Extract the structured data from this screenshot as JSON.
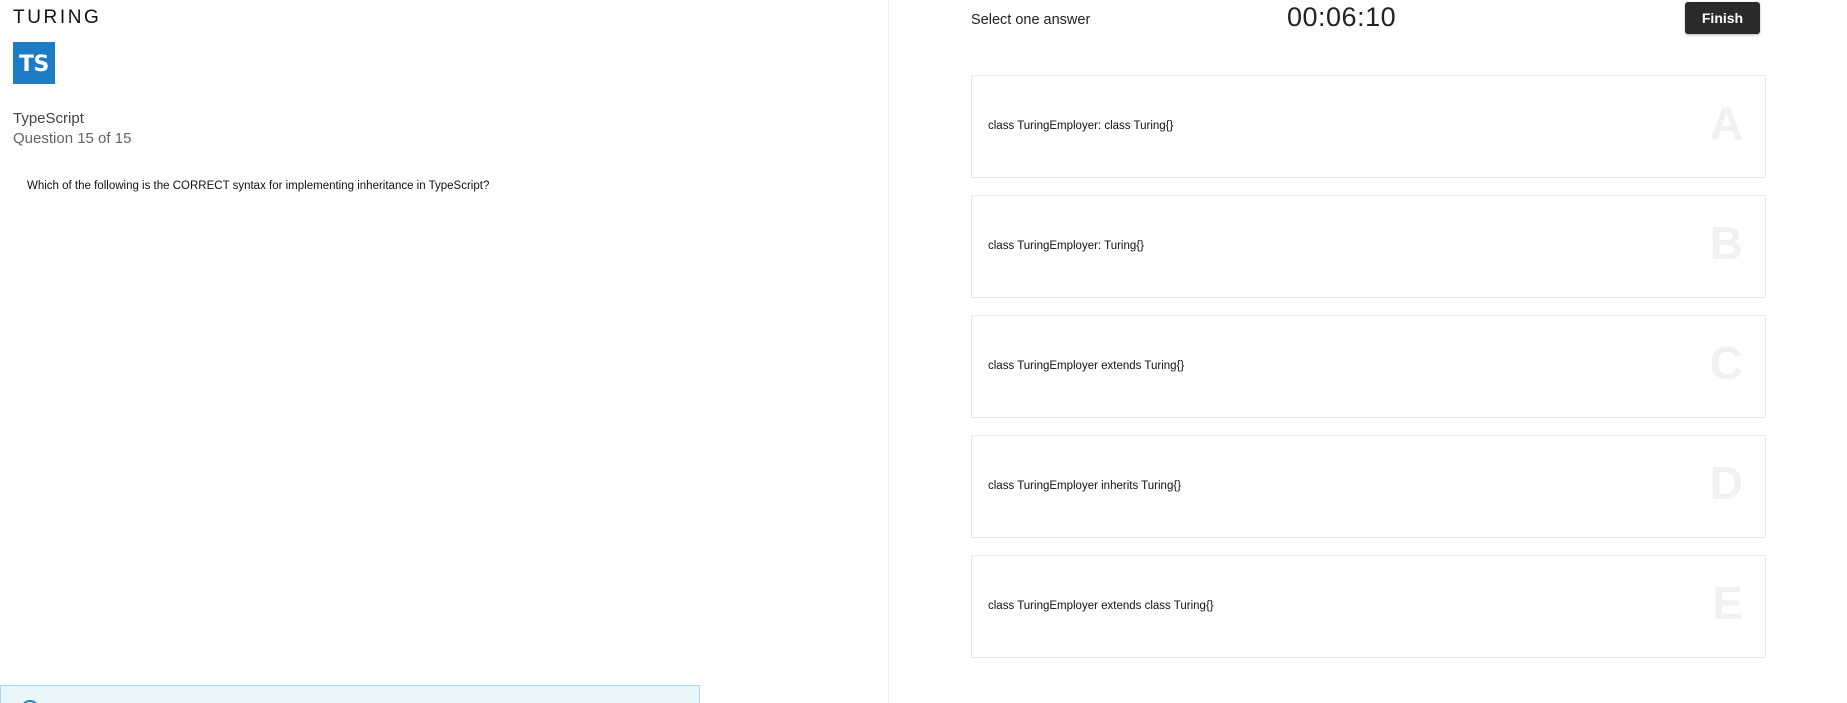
{
  "brand": {
    "logo_text": "TURING"
  },
  "subject": {
    "badge_text": "TS",
    "name": "TypeScript",
    "progress": "Question 15 of 15"
  },
  "question": {
    "text": "Which of the following is the CORRECT syntax for implementing inheritance in TypeScript?"
  },
  "header": {
    "instruction": "Select one answer",
    "timer": "00:06:10",
    "finish_label": "Finish"
  },
  "options": [
    {
      "letter": "A",
      "text": "class TuringEmployer: class Turing{}"
    },
    {
      "letter": "B",
      "text": "class TuringEmployer: Turing{}"
    },
    {
      "letter": "C",
      "text": "class TuringEmployer extends Turing{}"
    },
    {
      "letter": "D",
      "text": "class TuringEmployer inherits Turing{}"
    },
    {
      "letter": "E",
      "text": "class TuringEmployer extends class Turing{}"
    }
  ],
  "colors": {
    "badge": "#1e7bc6",
    "finish_button": "#2b2b2b",
    "info_banner": "#e9f6fc"
  },
  "icons": {
    "info": "info-icon"
  }
}
